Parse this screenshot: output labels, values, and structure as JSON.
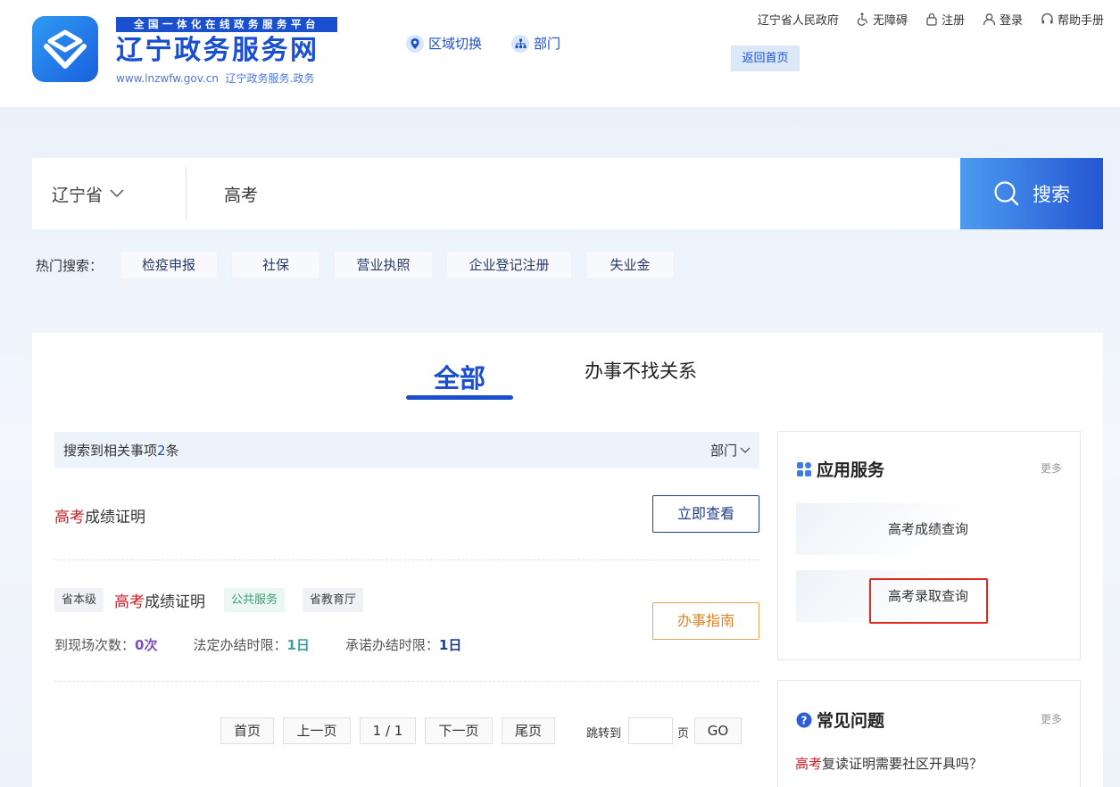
{
  "header": {
    "ribbon": "全国一体化在线政务服务平台",
    "name": "辽宁政务服务网",
    "sub_url": "www.lnzwfw.gov.cn",
    "sub_text": "辽宁政务服务.政务",
    "nav": [
      {
        "label": "区域切换",
        "icon": "location-pin-icon"
      },
      {
        "label": "部门",
        "icon": "org-chart-icon"
      }
    ],
    "top_links": [
      {
        "label": "辽宁省人民政府",
        "icon": ""
      },
      {
        "label": "无障碍",
        "icon": "wheelchair-icon"
      },
      {
        "label": "注册",
        "icon": "lock-icon"
      },
      {
        "label": "登录",
        "icon": "user-icon"
      },
      {
        "label": "帮助手册",
        "icon": "headset-icon"
      }
    ],
    "home_label": "返回首页"
  },
  "search": {
    "region": "辽宁省",
    "value": "高考",
    "button": "搜索",
    "hot_label": "热门搜索：",
    "hot_tags": [
      "检疫申报",
      "社保",
      "营业执照",
      "企业登记注册",
      "失业金"
    ]
  },
  "tabs": {
    "active": "全部",
    "other": "办事不找关系"
  },
  "results": {
    "summary_prefix": "搜索到相关事项",
    "count": "2",
    "summary_suffix": "条",
    "dept_filter": "部门",
    "item1": {
      "hl": "高考",
      "rest": "成绩证明",
      "button": "立即查看"
    },
    "item2": {
      "level": "省本级",
      "hl": "高考",
      "rest": "成绩证明",
      "category": "公共服务",
      "dept": "省教育厅",
      "visits_label": "到现场次数：",
      "visits": "0次",
      "legal_label": "法定办结时限：",
      "legal": "1日",
      "promise_label": "承诺办结时限：",
      "promise": "1日",
      "button": "办事指南"
    }
  },
  "pagination": {
    "first": "首页",
    "prev": "上一页",
    "current": "1 / 1",
    "next": "下一页",
    "last": "尾页",
    "jump_label": "跳转到",
    "page_suffix": "页",
    "go": "GO"
  },
  "app_services": {
    "title": "应用服务",
    "more": "更多",
    "items": [
      "高考成绩查询",
      "高考录取查询"
    ]
  },
  "faq": {
    "title": "常见问题",
    "more": "更多",
    "item_hl": "高考",
    "item_rest": "复读证明需要社区开具吗？"
  },
  "colors": {
    "primary": "#1a4fd0",
    "highlight": "#c5202a",
    "annotation": "#e0291f"
  }
}
